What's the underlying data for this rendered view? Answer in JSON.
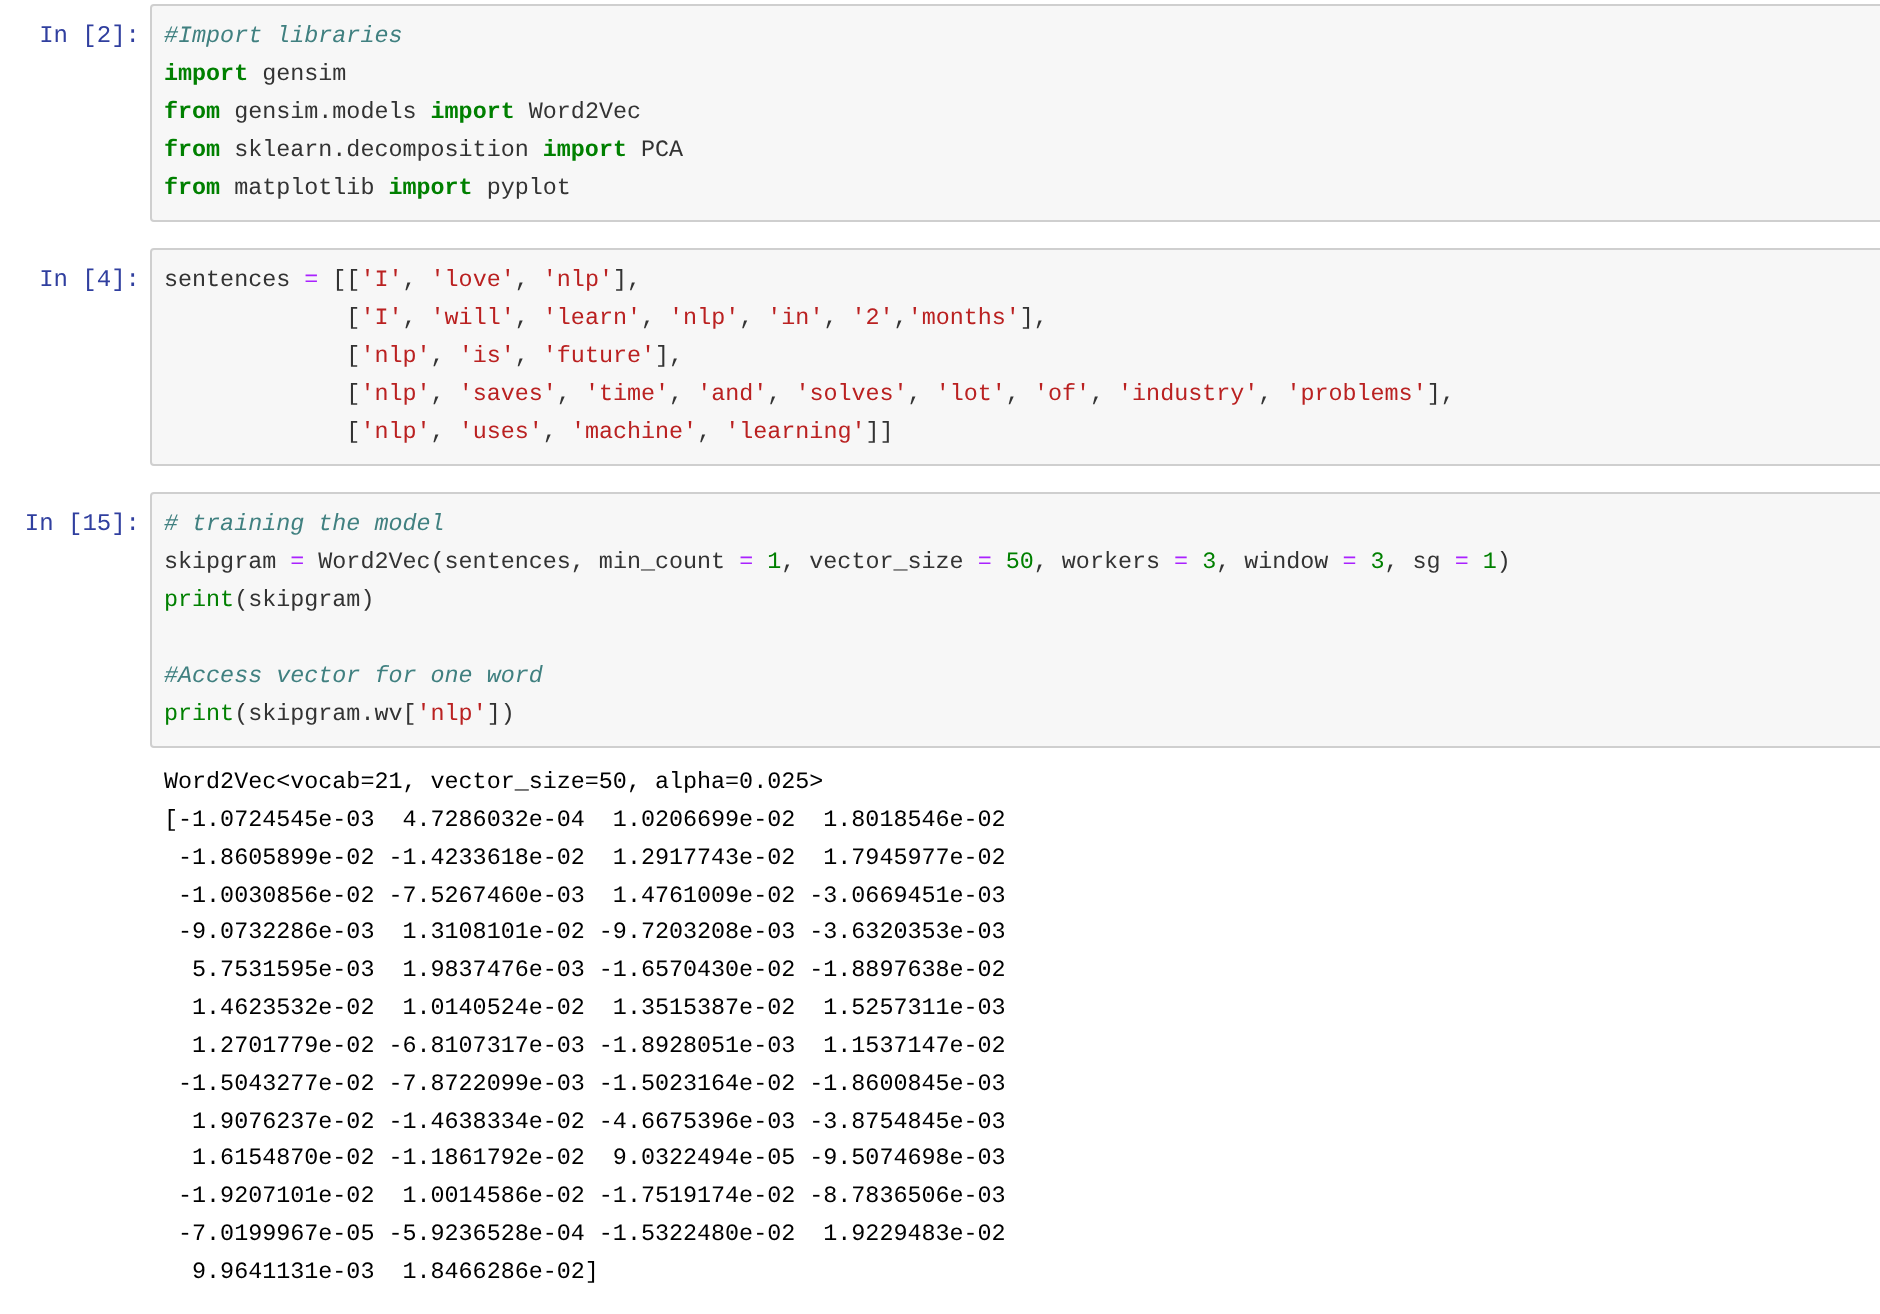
{
  "cells": [
    {
      "prompt": "In [2]:",
      "blocks": [
        [
          [
            {
              "kind": "comment",
              "text": "#Import libraries"
            }
          ],
          [
            {
              "kind": "keyword",
              "text": "import"
            },
            {
              "kind": "plain",
              "text": " gensim"
            }
          ],
          [
            {
              "kind": "keyword",
              "text": "from"
            },
            {
              "kind": "plain",
              "text": " gensim.models "
            },
            {
              "kind": "keyword",
              "text": "import"
            },
            {
              "kind": "plain",
              "text": " Word2Vec"
            }
          ],
          [
            {
              "kind": "keyword",
              "text": "from"
            },
            {
              "kind": "plain",
              "text": " sklearn.decomposition "
            },
            {
              "kind": "keyword",
              "text": "import"
            },
            {
              "kind": "plain",
              "text": " PCA"
            }
          ],
          [
            {
              "kind": "keyword",
              "text": "from"
            },
            {
              "kind": "plain",
              "text": " matplotlib "
            },
            {
              "kind": "keyword",
              "text": "import"
            },
            {
              "kind": "plain",
              "text": " pyplot"
            }
          ]
        ]
      ]
    },
    {
      "prompt": "In [4]:",
      "blocks": [
        [
          [
            {
              "kind": "plain",
              "text": "sentences"
            },
            {
              "kind": "operator",
              "text": " = "
            },
            {
              "kind": "plain",
              "text": "[["
            },
            {
              "kind": "string",
              "text": "'I'"
            },
            {
              "kind": "plain",
              "text": ", "
            },
            {
              "kind": "string",
              "text": "'love'"
            },
            {
              "kind": "plain",
              "text": ", "
            },
            {
              "kind": "string",
              "text": "'nlp'"
            },
            {
              "kind": "plain",
              "text": "],"
            }
          ],
          [
            {
              "kind": "plain",
              "text": "             ["
            },
            {
              "kind": "string",
              "text": "'I'"
            },
            {
              "kind": "plain",
              "text": ", "
            },
            {
              "kind": "string",
              "text": "'will'"
            },
            {
              "kind": "plain",
              "text": ", "
            },
            {
              "kind": "string",
              "text": "'learn'"
            },
            {
              "kind": "plain",
              "text": ", "
            },
            {
              "kind": "string",
              "text": "'nlp'"
            },
            {
              "kind": "plain",
              "text": ", "
            },
            {
              "kind": "string",
              "text": "'in'"
            },
            {
              "kind": "plain",
              "text": ", "
            },
            {
              "kind": "string",
              "text": "'2'"
            },
            {
              "kind": "plain",
              "text": ","
            },
            {
              "kind": "string",
              "text": "'months'"
            },
            {
              "kind": "plain",
              "text": "],"
            }
          ],
          [
            {
              "kind": "plain",
              "text": "             ["
            },
            {
              "kind": "string",
              "text": "'nlp'"
            },
            {
              "kind": "plain",
              "text": ", "
            },
            {
              "kind": "string",
              "text": "'is'"
            },
            {
              "kind": "plain",
              "text": ", "
            },
            {
              "kind": "string",
              "text": "'future'"
            },
            {
              "kind": "plain",
              "text": "],"
            }
          ],
          [
            {
              "kind": "plain",
              "text": "             ["
            },
            {
              "kind": "string",
              "text": "'nlp'"
            },
            {
              "kind": "plain",
              "text": ", "
            },
            {
              "kind": "string",
              "text": "'saves'"
            },
            {
              "kind": "plain",
              "text": ", "
            },
            {
              "kind": "string",
              "text": "'time'"
            },
            {
              "kind": "plain",
              "text": ", "
            },
            {
              "kind": "string",
              "text": "'and'"
            },
            {
              "kind": "plain",
              "text": ", "
            },
            {
              "kind": "string",
              "text": "'solves'"
            },
            {
              "kind": "plain",
              "text": ", "
            },
            {
              "kind": "string",
              "text": "'lot'"
            },
            {
              "kind": "plain",
              "text": ", "
            },
            {
              "kind": "string",
              "text": "'of'"
            },
            {
              "kind": "plain",
              "text": ", "
            },
            {
              "kind": "string",
              "text": "'industry'"
            },
            {
              "kind": "plain",
              "text": ", "
            },
            {
              "kind": "string",
              "text": "'problems'"
            },
            {
              "kind": "plain",
              "text": "],"
            }
          ],
          [
            {
              "kind": "plain",
              "text": "             ["
            },
            {
              "kind": "string",
              "text": "'nlp'"
            },
            {
              "kind": "plain",
              "text": ", "
            },
            {
              "kind": "string",
              "text": "'uses'"
            },
            {
              "kind": "plain",
              "text": ", "
            },
            {
              "kind": "string",
              "text": "'machine'"
            },
            {
              "kind": "plain",
              "text": ", "
            },
            {
              "kind": "string",
              "text": "'learning'"
            },
            {
              "kind": "plain",
              "text": "]]"
            }
          ]
        ]
      ]
    },
    {
      "prompt": "In [15]:",
      "blocks": [
        [
          [
            {
              "kind": "comment",
              "text": "# training the model"
            }
          ],
          [
            {
              "kind": "plain",
              "text": "skipgram"
            },
            {
              "kind": "operator",
              "text": " = "
            },
            {
              "kind": "plain",
              "text": "Word2Vec(sentences, min_count"
            },
            {
              "kind": "operator",
              "text": " = "
            },
            {
              "kind": "number",
              "text": "1"
            },
            {
              "kind": "plain",
              "text": ", vector_size"
            },
            {
              "kind": "operator",
              "text": " = "
            },
            {
              "kind": "number",
              "text": "50"
            },
            {
              "kind": "plain",
              "text": ", workers"
            },
            {
              "kind": "operator",
              "text": " = "
            },
            {
              "kind": "number",
              "text": "3"
            },
            {
              "kind": "plain",
              "text": ", window"
            },
            {
              "kind": "operator",
              "text": " = "
            },
            {
              "kind": "number",
              "text": "3"
            },
            {
              "kind": "plain",
              "text": ", sg"
            },
            {
              "kind": "operator",
              "text": " = "
            },
            {
              "kind": "number",
              "text": "1"
            },
            {
              "kind": "plain",
              "text": ")"
            }
          ],
          [
            {
              "kind": "builtin",
              "text": "print"
            },
            {
              "kind": "plain",
              "text": "(skipgram)"
            }
          ]
        ],
        [
          [
            {
              "kind": "comment",
              "text": "#Access vector for one word"
            }
          ],
          [
            {
              "kind": "builtin",
              "text": "print"
            },
            {
              "kind": "plain",
              "text": "(skipgram.wv["
            },
            {
              "kind": "string",
              "text": "'nlp'"
            },
            {
              "kind": "plain",
              "text": "])"
            }
          ]
        ]
      ],
      "output": [
        "Word2Vec<vocab=21, vector_size=50, alpha=0.025>",
        "[-1.0724545e-03  4.7286032e-04  1.0206699e-02  1.8018546e-02",
        " -1.8605899e-02 -1.4233618e-02  1.2917743e-02  1.7945977e-02",
        " -1.0030856e-02 -7.5267460e-03  1.4761009e-02 -3.0669451e-03",
        " -9.0732286e-03  1.3108101e-02 -9.7203208e-03 -3.6320353e-03",
        "  5.7531595e-03  1.9837476e-03 -1.6570430e-02 -1.8897638e-02",
        "  1.4623532e-02  1.0140524e-02  1.3515387e-02  1.5257311e-03",
        "  1.2701779e-02 -6.8107317e-03 -1.8928051e-03  1.1537147e-02",
        " -1.5043277e-02 -7.8722099e-03 -1.5023164e-02 -1.8600845e-03",
        "  1.9076237e-02 -1.4638334e-02 -4.6675396e-03 -3.8754845e-03",
        "  1.6154870e-02 -1.1861792e-02  9.0322494e-05 -9.5074698e-03",
        " -1.9207101e-02  1.0014586e-02 -1.7519174e-02 -8.7836506e-03",
        " -7.0199967e-05 -5.9236528e-04 -1.5322480e-02  1.9229483e-02",
        "  9.9641131e-03  1.8466286e-02]"
      ]
    }
  ]
}
